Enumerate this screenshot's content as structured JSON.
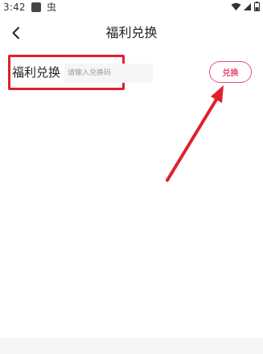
{
  "status_bar": {
    "time": "3:42",
    "app_icon_glyph": "虫",
    "icons": [
      "square-notification-icon",
      "wifi-icon",
      "signal-icon",
      "battery-icon"
    ]
  },
  "nav": {
    "back_icon": "chevron-left-icon",
    "title": "福利兑换"
  },
  "redeem": {
    "label": "福利兑换",
    "input_placeholder": "请输入兑换码",
    "input_value": "",
    "button_label": "兑换"
  },
  "colors": {
    "accent_pink": "#e24a72",
    "annotation_red": "#e0202b"
  }
}
